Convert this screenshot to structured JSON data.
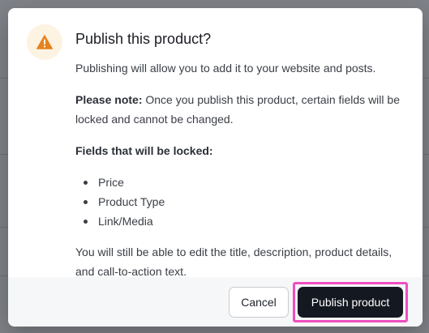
{
  "dialog": {
    "title": "Publish this product?",
    "intro": "Publishing will allow you to add it to your website and posts.",
    "note_label": "Please note:",
    "note_text": " Once you publish this product, certain fields will be locked and cannot be changed.",
    "locked_heading": "Fields that will be locked:",
    "locked_fields": [
      "Price",
      "Product Type",
      "Link/Media"
    ],
    "editable_text": "You will still be able to edit the title, description, product details, and call-to-action text.",
    "icon": "warning-triangle-icon",
    "colors": {
      "warning": "#e5821f",
      "warning_bg": "#fdf3e2",
      "primary_button": "#141820",
      "highlight": "#ee4fc0"
    }
  },
  "footer": {
    "cancel_label": "Cancel",
    "publish_label": "Publish product"
  }
}
